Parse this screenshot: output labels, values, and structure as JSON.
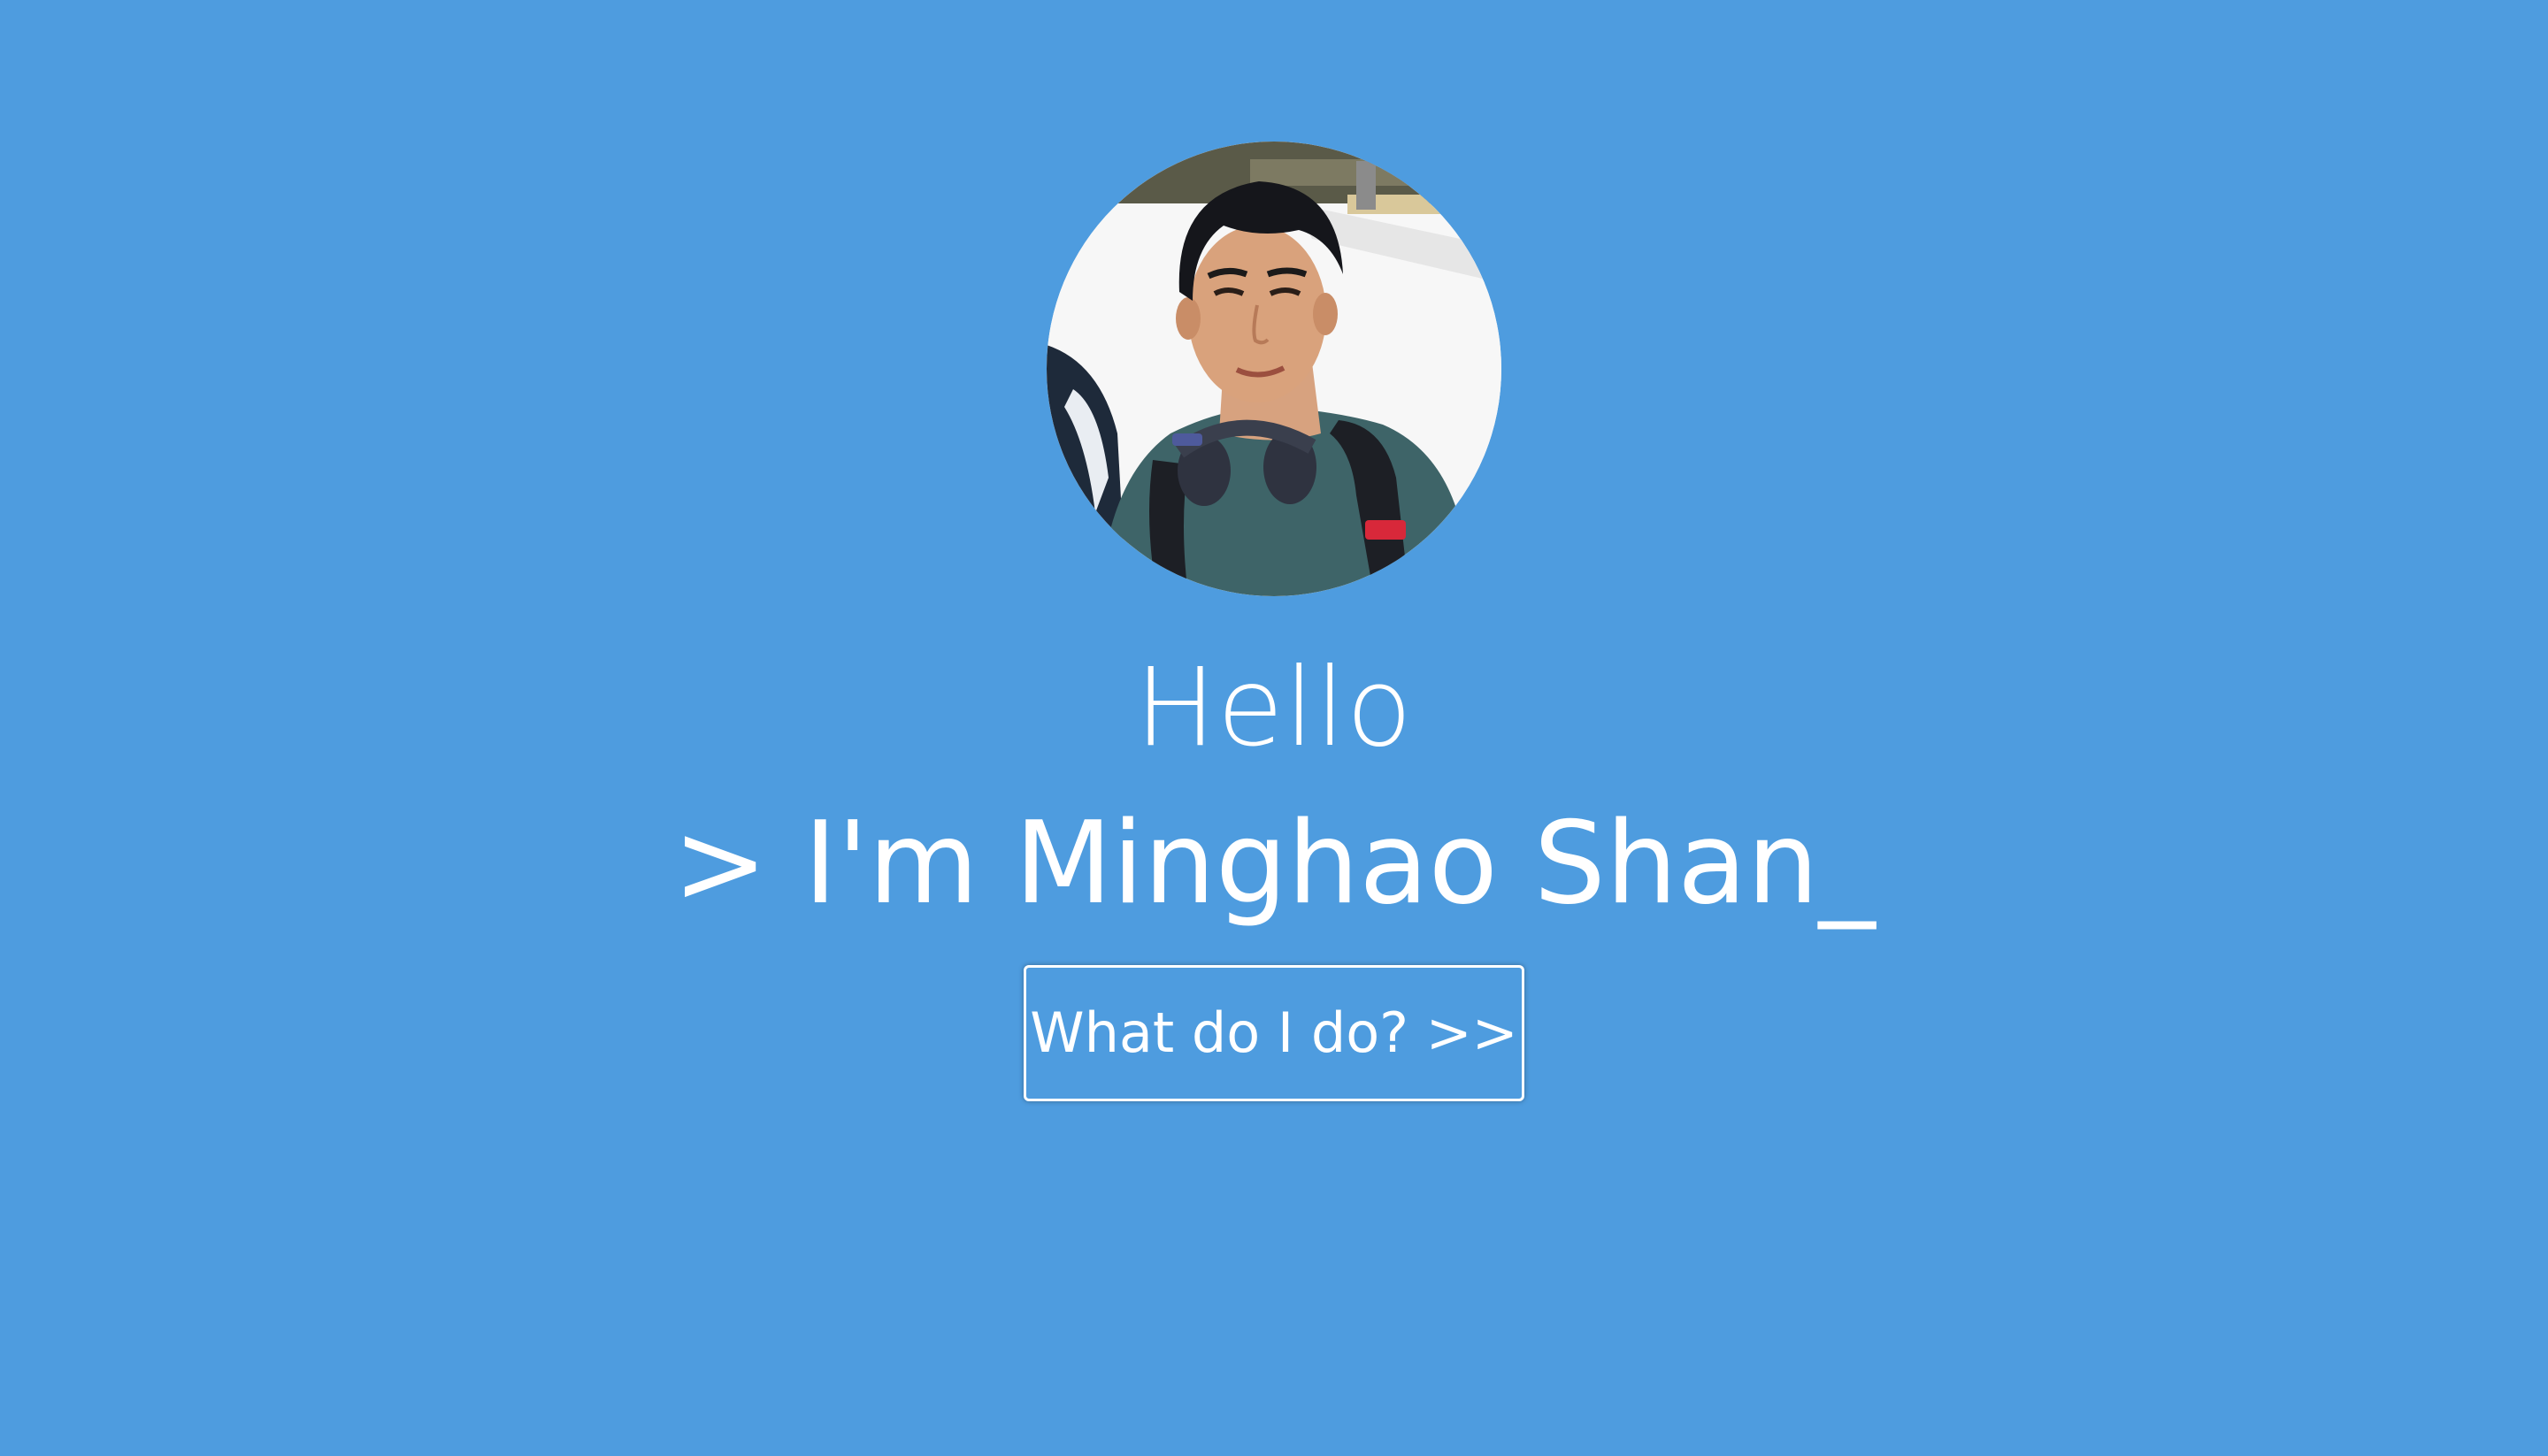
{
  "hero": {
    "avatar_alt": "profile photo",
    "greeting": "Hello",
    "intro": "> I'm Minghao Shan_",
    "cta_label": "What do I do? >>"
  },
  "colors": {
    "background": "#4e9cdf",
    "text": "#ffffff",
    "button_border": "#ffffff"
  }
}
